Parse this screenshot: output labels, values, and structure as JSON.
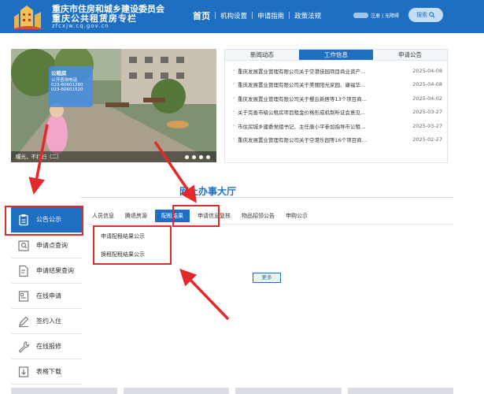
{
  "header": {
    "title_line1": "重庆市住房和城乡建设委员会",
    "title_line2": "重庆公共租赁房专栏",
    "url": "zfcxjw.cq.gov.cn",
    "nav": {
      "home": "首页",
      "sep": "|",
      "items": [
        "机构设置",
        "申请指南",
        "政策法规"
      ]
    },
    "user_links": "注册 | 无障碍",
    "search_label": "搜索"
  },
  "slider": {
    "caption": "曝光，不打扫（二）",
    "phone_card": {
      "title": "公租房",
      "subtitle": "公开咨询电话",
      "phone1": "023-60601260",
      "phone2": "023-60601520"
    }
  },
  "news_tabs": {
    "tabs": [
      "新闻动态",
      "工作信息",
      "申请公告"
    ],
    "active_index": 1,
    "items": [
      {
        "title": "重庆发展置业管理有限公司关于空港佳园项目商业资产...",
        "date": "2025-04-08"
      },
      {
        "title": "重庆发展置业管理有限公司关于美丽阳光家园、康福华...",
        "date": "2025-04-08"
      },
      {
        "title": "重庆发展置业管理有限公司关于樱云新居等13个项目商...",
        "date": "2025-04-02"
      },
      {
        "title": "关于完善市级公租房项目租金价格形成机制听证会意见...",
        "date": "2025-03-27"
      },
      {
        "title": "市住房城乡建委党组书记、主任唐小平参加指导市公租...",
        "date": "2025-03-27"
      },
      {
        "title": "重庆发展置业管理有限公司关于空港乐园等16个项目商...",
        "date": "2025-02-27"
      }
    ]
  },
  "service_hall": {
    "title": "网上办事大厅",
    "sidebar": [
      {
        "label": "公告公示",
        "icon": "clipboard-icon",
        "active": true
      },
      {
        "label": "申请点查询",
        "icon": "map-search-icon"
      },
      {
        "label": "申请结果查询",
        "icon": "document-search-icon"
      },
      {
        "label": "在线申请",
        "icon": "form-icon"
      },
      {
        "label": "签约入住",
        "icon": "pen-icon"
      },
      {
        "label": "在线报修",
        "icon": "wrench-icon"
      },
      {
        "label": "表格下载",
        "icon": "download-icon"
      }
    ],
    "sub_tabs": [
      "人员信息",
      "腾退房源",
      "配租结果",
      "申请信息复核",
      "物品招领公告",
      "申购公示"
    ],
    "active_sub_tab": 2,
    "results": [
      "申请配租结果公示",
      "换租配租结果公示"
    ],
    "more_label": "更多"
  },
  "colors": {
    "primary": "#1e6fc2",
    "highlight": "#e32a2a"
  }
}
